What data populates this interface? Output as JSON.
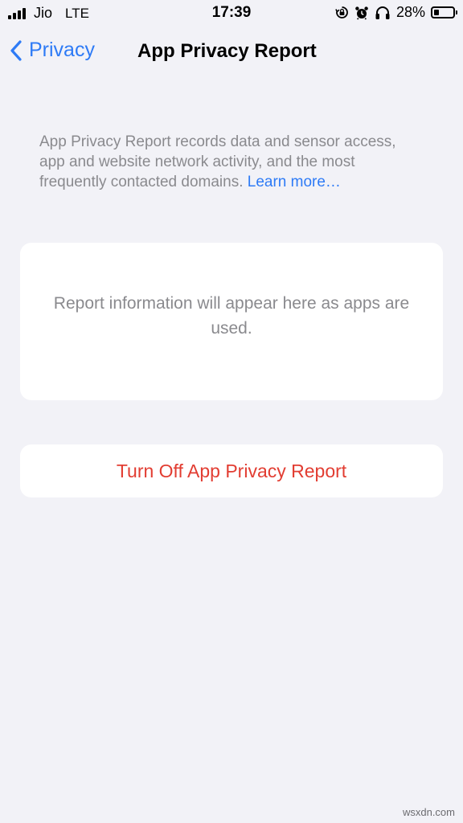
{
  "status_bar": {
    "carrier": "Jio",
    "network": "LTE",
    "time": "17:39",
    "battery_percent": "28%",
    "battery_level": 0.28,
    "icons": [
      "signal-bars-icon",
      "orientation-lock-icon",
      "alarm-icon",
      "headphones-icon",
      "battery-icon"
    ]
  },
  "nav": {
    "back_label": "Privacy",
    "title": "App Privacy Report"
  },
  "description": {
    "text": "App Privacy Report records data and sensor access, app and website network activity, and the most frequently contacted domains. ",
    "link": "Learn more…"
  },
  "report_card": {
    "message": "Report information will appear here as apps are used."
  },
  "actions": {
    "turn_off_label": "Turn Off App Privacy Report"
  },
  "colors": {
    "background": "#f2f2f7",
    "accent_blue": "#2e7bf6",
    "destructive_red": "#e23d32",
    "secondary_text": "#8a8a8e"
  },
  "watermark": "wsxdn.com"
}
